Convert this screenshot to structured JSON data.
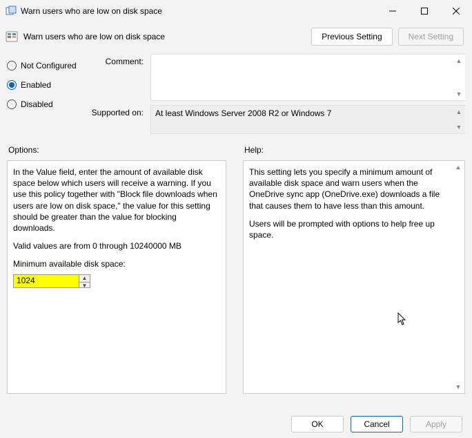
{
  "window": {
    "title": "Warn users who are low on disk space"
  },
  "header": {
    "subtitle": "Warn users who are low on disk space",
    "prev_label": "Previous Setting",
    "next_label": "Next Setting"
  },
  "state": {
    "not_configured": "Not Configured",
    "enabled": "Enabled",
    "disabled": "Disabled",
    "selected": "enabled"
  },
  "comment": {
    "label": "Comment:",
    "value": ""
  },
  "supported": {
    "label": "Supported on:",
    "value": "At least Windows Server 2008 R2 or Windows 7"
  },
  "options": {
    "label": "Options:",
    "description": "In the Value field, enter the amount of available disk space below which users will receive a warning. If you use this policy together with \"Block file downloads when users are low on disk space,\" the value for this setting should be greater than the value for blocking downloads.",
    "valid_values": "Valid values are from 0 through 10240000 MB",
    "field_label": "Minimum available disk space:",
    "field_value": "1024"
  },
  "help": {
    "label": "Help:",
    "para1": "This setting lets you specify a minimum amount of available disk space and warn users when the OneDrive sync app (OneDrive.exe) downloads a file that causes them to have less than this amount.",
    "para2": "Users will be prompted with options to help free up space."
  },
  "buttons": {
    "ok": "OK",
    "cancel": "Cancel",
    "apply": "Apply"
  }
}
